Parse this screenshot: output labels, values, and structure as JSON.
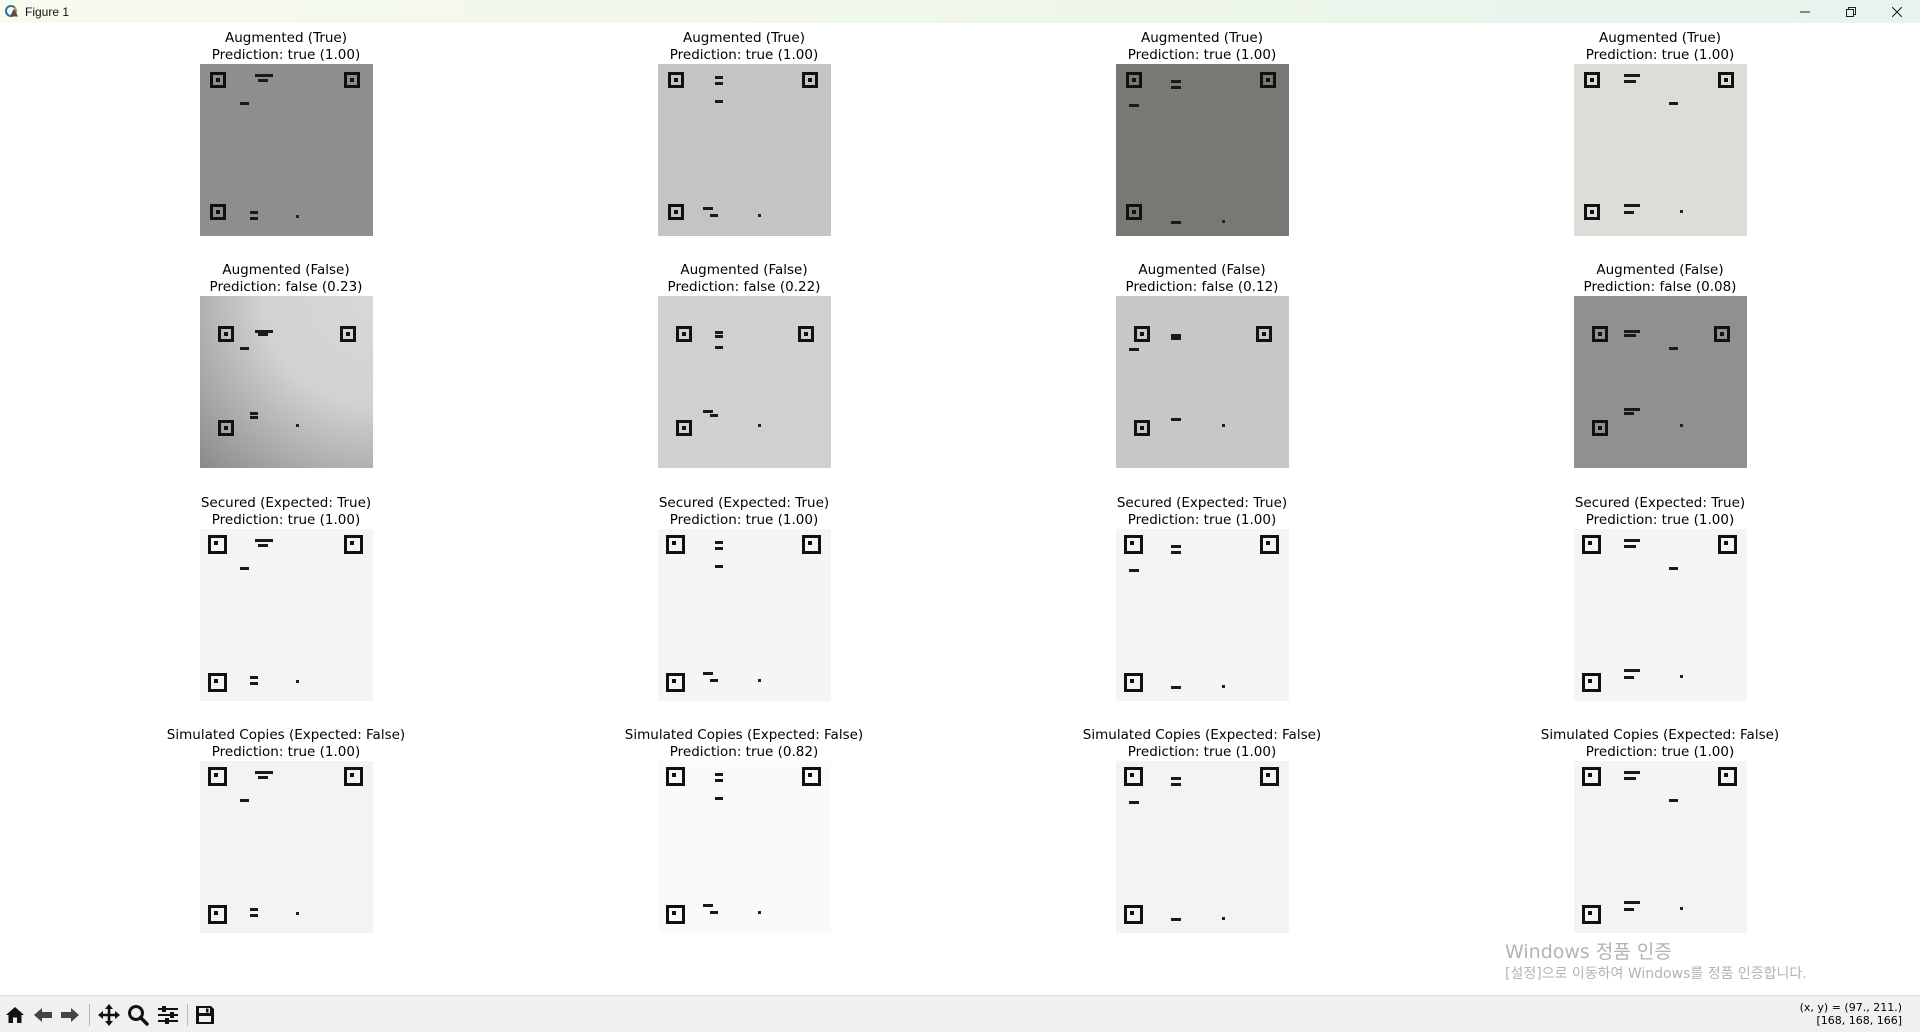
{
  "window": {
    "title": "Figure 1",
    "app_icon": "matplotlib-icon",
    "controls": [
      "minimize-icon",
      "restore-icon",
      "close-icon"
    ]
  },
  "figure": {
    "panels": [
      {
        "title": "Augmented (True)",
        "prediction": "Prediction: true (1.00)",
        "bg": "#8e8f8d",
        "tone": "dark"
      },
      {
        "title": "Augmented (True)",
        "prediction": "Prediction: true (1.00)",
        "bg": "#c4c5c3",
        "tone": "light"
      },
      {
        "title": "Augmented (True)",
        "prediction": "Prediction: true (1.00)",
        "bg": "#7a7874",
        "tone": "dark"
      },
      {
        "title": "Augmented (True)",
        "prediction": "Prediction: true (1.00)",
        "bg": "#dcdcd8",
        "tone": "light"
      },
      {
        "title": "Augmented (False)",
        "prediction": "Prediction: false (0.23)",
        "bg": "#cfcfcf",
        "tone": "shadow"
      },
      {
        "title": "Augmented (False)",
        "prediction": "Prediction: false (0.22)",
        "bg": "#cfd0d0",
        "tone": "light"
      },
      {
        "title": "Augmented (False)",
        "prediction": "Prediction: false (0.12)",
        "bg": "#c6c7c7",
        "tone": "light"
      },
      {
        "title": "Augmented (False)",
        "prediction": "Prediction: false (0.08)",
        "bg": "#8f908f",
        "tone": "dark"
      },
      {
        "title": "Secured (Expected: True)",
        "prediction": "Prediction: true (1.00)",
        "bg": "#f4f4f4",
        "tone": "white"
      },
      {
        "title": "Secured (Expected: True)",
        "prediction": "Prediction: true (1.00)",
        "bg": "#f5f5f5",
        "tone": "white"
      },
      {
        "title": "Secured (Expected: True)",
        "prediction": "Prediction: true (1.00)",
        "bg": "#f4f4f4",
        "tone": "white"
      },
      {
        "title": "Secured (Expected: True)",
        "prediction": "Prediction: true (1.00)",
        "bg": "#f5f5f5",
        "tone": "white"
      },
      {
        "title": "Simulated Copies (Expected: False)",
        "prediction": "Prediction: true (1.00)",
        "bg": "#f3f3f3",
        "tone": "white"
      },
      {
        "title": "Simulated Copies (Expected: False)",
        "prediction": "Prediction: true (0.82)",
        "bg": "#fafafa",
        "tone": "white"
      },
      {
        "title": "Simulated Copies (Expected: False)",
        "prediction": "Prediction: true (1.00)",
        "bg": "#f3f3f3",
        "tone": "white"
      },
      {
        "title": "Simulated Copies (Expected: False)",
        "prediction": "Prediction: true (1.00)",
        "bg": "#f4f4f4",
        "tone": "white"
      }
    ]
  },
  "watermark": {
    "line1": "Windows 정품 인증",
    "line2": "[설정]으로 이동하여 Windows를 정품 인증합니다."
  },
  "toolbar": {
    "buttons": [
      "home-icon",
      "back-icon",
      "forward-icon",
      "pan-icon",
      "zoom-icon",
      "configure-subplots-icon",
      "save-icon"
    ]
  },
  "status": {
    "coords": "(x, y) = (97., 211.)",
    "pixel": "[168, 168, 166]"
  }
}
